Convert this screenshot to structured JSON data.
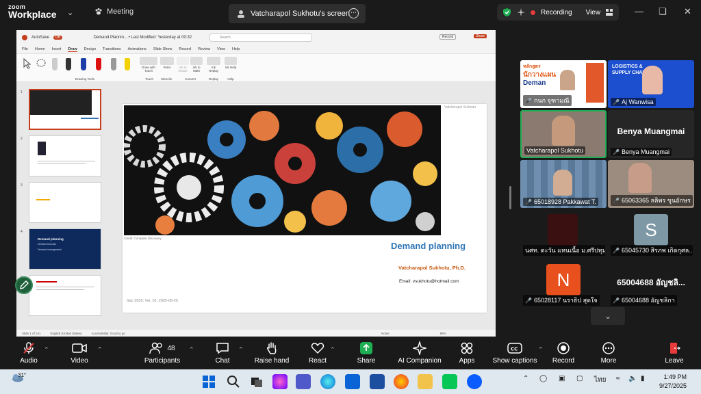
{
  "app": {
    "brand_top": "zoom",
    "brand_bottom": "Workplace",
    "meeting_label": "Meeting",
    "screen_title": "Vatcharapol Sukhotu's screen",
    "recording_label": "Recording",
    "view_label": "View"
  },
  "ppt": {
    "autosave": "AutoSave",
    "autosave_state": "Off",
    "doc_title": "Demand Plannin... • Last Modified: Yesterday at 00:32",
    "search_placeholder": "Search",
    "record_btn": "Record",
    "share_btn": "Share",
    "menu": [
      "File",
      "Home",
      "Insert",
      "Draw",
      "Design",
      "Transitions",
      "Animations",
      "Slide Show",
      "Record",
      "Review",
      "View",
      "Help"
    ],
    "active_menu": "Draw",
    "ribbon_groups": [
      "Drawing Tools",
      "Touch",
      "Stencils",
      "Convert",
      "Replay",
      "Help"
    ],
    "ribbon_items": [
      "Draw with Touch",
      "Ruler",
      "Ink to Shape",
      "Ink to Math",
      "Ink Replay",
      "Ink Help"
    ],
    "thumbnail_numbers": [
      "1",
      "2",
      "3",
      "4",
      "5"
    ],
    "thumb4_line1": "Demand planning",
    "thumb4_line2": "Demand forecast",
    "thumb4_line3": "Demand management",
    "status_left": "Slide 1 of 141",
    "status_lang": "English (United States)",
    "status_access": "Accessibility: Good to go",
    "notes": "Notes",
    "zoom_level": "98%"
  },
  "slide": {
    "title": "Demand planning",
    "author": "Vatcharapol Sukhotu, Ph.D.",
    "email": "Email: vsukhotu@hotmail.com",
    "footer": "Sep 2025; Ver. 01; 2025-09-25",
    "credit": "Credit: Complete Discovery",
    "name_tag": "Vatcharapol Sukhotu"
  },
  "participants": [
    {
      "label": "กนก จุฑามณี",
      "muted": true
    },
    {
      "label": "Aj Wanwisa",
      "muted": true
    },
    {
      "label": "Vatcharapol Sukhotu",
      "muted": false
    },
    {
      "label": "Benya Muangmai",
      "muted": true,
      "big_name": "Benya Muangmai"
    },
    {
      "label": "65018928 Pakkawat T.",
      "muted": true
    },
    {
      "label": "65063365 ลลิพร ขุนอักษร",
      "muted": true
    },
    {
      "label": "นศท. ตะวัน แหนเนื้อ ม.ศรีปทุม",
      "muted": false
    },
    {
      "label": "65045730 สิรภพ เกิดกุศล...",
      "muted": true,
      "avatar": "S"
    },
    {
      "label": "65028117 นราธิป สุดใจ",
      "muted": true,
      "avatar": "N"
    },
    {
      "label": "65004688 อัญชลิกา",
      "muted": true,
      "big_name": "65004688 อัญชลิ..."
    }
  ],
  "tile_promos": {
    "t1_line1": "หลักสูตร",
    "t1_line2": "นักวางแผน",
    "t1_line3": "Deman",
    "t2_line1": "LOGISTICS &",
    "t2_line2": "SUPPLY CHAI"
  },
  "toolbar": {
    "audio": "Audio",
    "video": "Video",
    "participants": "Participants",
    "participant_count": "48",
    "chat": "Chat",
    "raise_hand": "Raise hand",
    "react": "React",
    "share": "Share",
    "ai_companion": "AI Companion",
    "apps": "Apps",
    "show_captions": "Show captions",
    "record": "Record",
    "more": "More",
    "leave": "Leave"
  },
  "taskbar": {
    "weather_temp": "31°",
    "lang": "ไทย",
    "time": "1:49 PM",
    "date": "9/27/2025"
  },
  "colors": {
    "accent_green": "#1fae53",
    "record_red": "#e83b3b",
    "slide_title_blue": "#2e75b6",
    "author_orange": "#c55a11",
    "ppt_accent": "#c43e1c"
  }
}
